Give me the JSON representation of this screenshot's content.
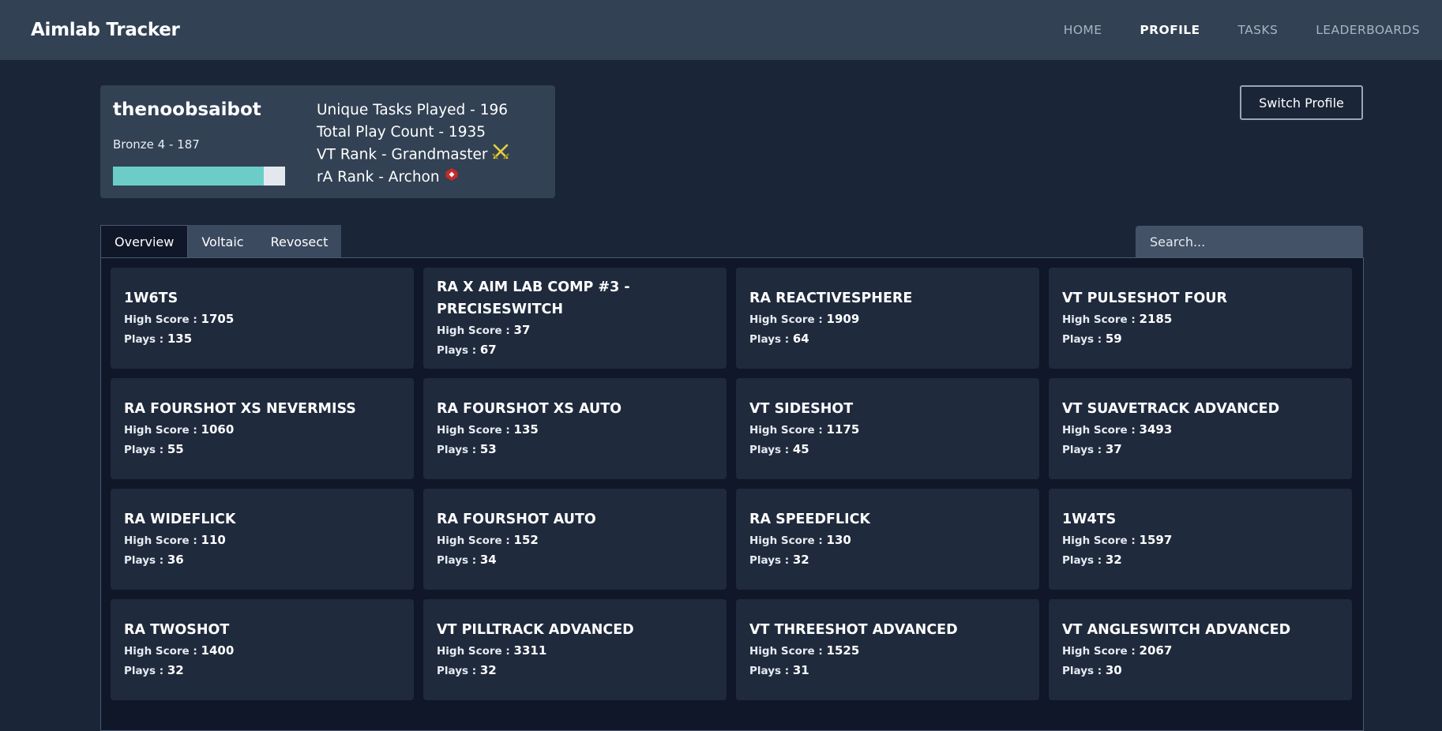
{
  "app": {
    "title": "Aimlab Tracker"
  },
  "nav": {
    "items": [
      {
        "label": "HOME",
        "active": false
      },
      {
        "label": "PROFILE",
        "active": true
      },
      {
        "label": "TASKS",
        "active": false
      },
      {
        "label": "LEADERBOARDS",
        "active": false
      }
    ]
  },
  "profile": {
    "username": "thenoobsaibot",
    "rank_text": "Bronze 4 - 187",
    "rank_progress_fraction": 0.875,
    "stats": {
      "unique_tasks": "Unique Tasks Played - 196",
      "play_count": "Total Play Count - 1935",
      "vt_rank": "VT Rank - Grandmaster",
      "ra_rank": "rA Rank - Archon"
    },
    "vt_rank_icon": "crossed-swords-icon",
    "ra_rank_icon": "archon-badge-icon",
    "switch_label": "Switch Profile"
  },
  "tabs": [
    {
      "label": "Overview",
      "active": true
    },
    {
      "label": "Voltaic",
      "active": false
    },
    {
      "label": "Revosect",
      "active": false
    }
  ],
  "search": {
    "placeholder": "Search..."
  },
  "labels": {
    "high_score": "High Score : ",
    "plays": "Plays : "
  },
  "tasks": [
    {
      "name": "1W6TS",
      "high_score": "1705",
      "plays": "135"
    },
    {
      "name": "RA X AIM LAB COMP #3 - PRECISESWITCH",
      "high_score": "37",
      "plays": "67"
    },
    {
      "name": "RA REACTIVESPHERE",
      "high_score": "1909",
      "plays": "64"
    },
    {
      "name": "VT PULSESHOT FOUR",
      "high_score": "2185",
      "plays": "59"
    },
    {
      "name": "RA FOURSHOT XS NEVERMISS",
      "high_score": "1060",
      "plays": "55"
    },
    {
      "name": "RA FOURSHOT XS AUTO",
      "high_score": "135",
      "plays": "53"
    },
    {
      "name": "VT SIDESHOT",
      "high_score": "1175",
      "plays": "45"
    },
    {
      "name": "VT SUAVETRACK ADVANCED",
      "high_score": "3493",
      "plays": "37"
    },
    {
      "name": "RA WIDEFLICK",
      "high_score": "110",
      "plays": "36"
    },
    {
      "name": "RA FOURSHOT AUTO",
      "high_score": "152",
      "plays": "34"
    },
    {
      "name": "RA SPEEDFLICK",
      "high_score": "130",
      "plays": "32"
    },
    {
      "name": "1W4TS",
      "high_score": "1597",
      "plays": "32"
    },
    {
      "name": "RA TWOSHOT",
      "high_score": "1400",
      "plays": "32"
    },
    {
      "name": "VT PILLTRACK ADVANCED",
      "high_score": "3311",
      "plays": "32"
    },
    {
      "name": "VT THREESHOT ADVANCED",
      "high_score": "1525",
      "plays": "31"
    },
    {
      "name": "VT ANGLESWITCH ADVANCED",
      "high_score": "2067",
      "plays": "30"
    }
  ]
}
